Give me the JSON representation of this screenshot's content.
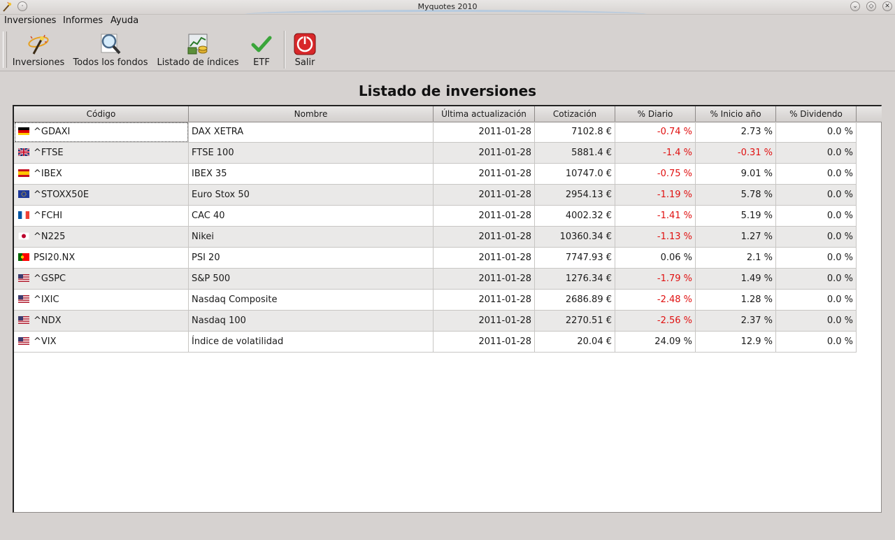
{
  "window": {
    "title": "Myquotes 2010"
  },
  "menu": [
    "Inversiones",
    "Informes",
    "Ayuda"
  ],
  "toolbar": [
    {
      "label": "Inversiones",
      "icon": "magic-wand-icon"
    },
    {
      "label": "Todos los fondos",
      "icon": "magnifier-icon"
    },
    {
      "label": "Listado de índices",
      "icon": "chart-money-icon"
    },
    {
      "label": "ETF",
      "icon": "checkmark-icon"
    },
    {
      "label": "Salir",
      "icon": "power-icon"
    }
  ],
  "page_title": "Listado de inversiones",
  "table": {
    "columns": [
      "Código",
      "Nombre",
      "Última actualización",
      "Cotización",
      "% Diario",
      "% Inicio año",
      "% Dividendo"
    ],
    "rows": [
      {
        "flag": "de",
        "code": "^GDAXI",
        "name": "DAX XETRA",
        "updated": "2011-01-28",
        "quote": "7102.8 €",
        "daily": "-0.74 %",
        "ytd": "2.73 %",
        "dividend": "0.0 %"
      },
      {
        "flag": "gb",
        "code": "^FTSE",
        "name": "FTSE 100",
        "updated": "2011-01-28",
        "quote": "5881.4 €",
        "daily": "-1.4 %",
        "ytd": "-0.31 %",
        "dividend": "0.0 %"
      },
      {
        "flag": "es",
        "code": "^IBEX",
        "name": "IBEX 35",
        "updated": "2011-01-28",
        "quote": "10747.0 €",
        "daily": "-0.75 %",
        "ytd": "9.01 %",
        "dividend": "0.0 %"
      },
      {
        "flag": "eu",
        "code": "^STOXX50E",
        "name": "Euro Stox 50",
        "updated": "2011-01-28",
        "quote": "2954.13 €",
        "daily": "-1.19 %",
        "ytd": "5.78 %",
        "dividend": "0.0 %"
      },
      {
        "flag": "fr",
        "code": "^FCHI",
        "name": "CAC 40",
        "updated": "2011-01-28",
        "quote": "4002.32 €",
        "daily": "-1.41 %",
        "ytd": "5.19 %",
        "dividend": "0.0 %"
      },
      {
        "flag": "jp",
        "code": "^N225",
        "name": "Nikei",
        "updated": "2011-01-28",
        "quote": "10360.34 €",
        "daily": "-1.13 %",
        "ytd": "1.27 %",
        "dividend": "0.0 %"
      },
      {
        "flag": "pt",
        "code": "PSI20.NX",
        "name": "PSI 20",
        "updated": "2011-01-28",
        "quote": "7747.93 €",
        "daily": "0.06 %",
        "ytd": "2.1 %",
        "dividend": "0.0 %"
      },
      {
        "flag": "us",
        "code": "^GSPC",
        "name": "S&P 500",
        "updated": "2011-01-28",
        "quote": "1276.34 €",
        "daily": "-1.79 %",
        "ytd": "1.49 %",
        "dividend": "0.0 %"
      },
      {
        "flag": "us",
        "code": "^IXIC",
        "name": "Nasdaq Composite",
        "updated": "2011-01-28",
        "quote": "2686.89 €",
        "daily": "-2.48 %",
        "ytd": "1.28 %",
        "dividend": "0.0 %"
      },
      {
        "flag": "us",
        "code": "^NDX",
        "name": "Nasdaq 100",
        "updated": "2011-01-28",
        "quote": "2270.51 €",
        "daily": "-2.56 %",
        "ytd": "2.37 %",
        "dividend": "0.0 %"
      },
      {
        "flag": "us",
        "code": "^VIX",
        "name": "Índice de volatilidad",
        "updated": "2011-01-28",
        "quote": "20.04 €",
        "daily": "24.09 %",
        "ytd": "12.9 %",
        "dividend": "0.0 %"
      }
    ]
  },
  "colors": {
    "negative": "#e01010",
    "row_alt": "#eae9e8",
    "window_bg": "#d6d2d0"
  }
}
